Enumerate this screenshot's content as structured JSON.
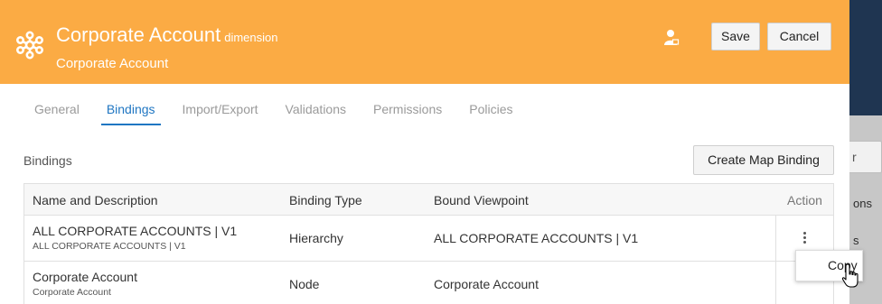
{
  "backdrop": {
    "button_fragment": "r",
    "text_fragment_1": "ons",
    "text_fragment_2": "s"
  },
  "header": {
    "icon": "dimension-molecule-icon",
    "title": "Corporate Account",
    "title_suffix": "dimension",
    "subtitle": "Corporate Account",
    "person_icon": "user-lock-icon",
    "save_label": "Save",
    "cancel_label": "Cancel",
    "color": "#fbab44"
  },
  "tabs": [
    {
      "label": "General",
      "active": false
    },
    {
      "label": "Bindings",
      "active": true
    },
    {
      "label": "Import/Export",
      "active": false
    },
    {
      "label": "Validations",
      "active": false
    },
    {
      "label": "Permissions",
      "active": false
    },
    {
      "label": "Policies",
      "active": false
    }
  ],
  "bindings": {
    "section_label": "Bindings",
    "create_button": "Create Map Binding",
    "columns": [
      "Name and Description",
      "Binding Type",
      "Bound Viewpoint",
      "Action"
    ],
    "rows": [
      {
        "name": "ALL CORPORATE ACCOUNTS | V1",
        "description": "ALL CORPORATE ACCOUNTS | V1",
        "type": "Hierarchy",
        "viewpoint": "ALL CORPORATE ACCOUNTS | V1"
      },
      {
        "name": "Corporate Account",
        "description": "Corporate Account",
        "type": "Node",
        "viewpoint": "Corporate Account"
      }
    ]
  },
  "context_menu": {
    "items": [
      "Copy"
    ]
  },
  "accent_color": "#1f76c2"
}
